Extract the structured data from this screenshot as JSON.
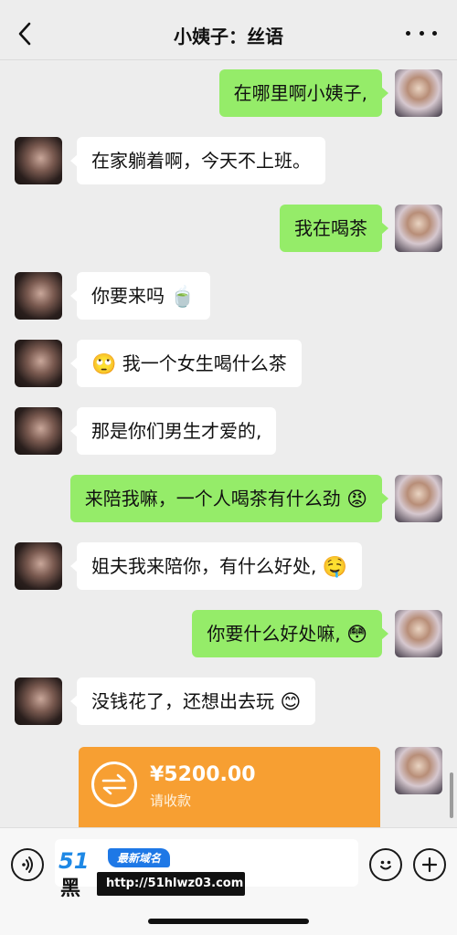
{
  "header": {
    "back_icon": "chevron-left-icon",
    "title": "小姨子：丝语",
    "more_icon": "more-dots-icon"
  },
  "messages": [
    {
      "sender": "me",
      "text": "在哪里啊小姨子,"
    },
    {
      "sender": "her",
      "text": "在家躺着啊，今天不上班。"
    },
    {
      "sender": "me",
      "text": "我在喝茶"
    },
    {
      "sender": "her",
      "text": "你要来吗",
      "emoji_after": "🍵"
    },
    {
      "sender": "her",
      "emoji_before": "🙄",
      "text": "我一个女生喝什么茶"
    },
    {
      "sender": "her",
      "text": "那是你们男生才爱的,"
    },
    {
      "sender": "me",
      "text": "来陪我嘛，一个人喝茶有什么劲",
      "emoji_after": "😡"
    },
    {
      "sender": "her",
      "text": "姐夫我来陪你，有什么好处,",
      "emoji_after": "🤤"
    },
    {
      "sender": "me",
      "text": "你要什么好处嘛,",
      "emoji_after": "😳"
    },
    {
      "sender": "her",
      "text": "没钱花了，还想出去玩",
      "emoji_after": "😊"
    }
  ],
  "transfer": {
    "amount": "¥5200.00",
    "status": "请收款",
    "icon": "transfer-arrows-icon",
    "color": "#f79f32"
  },
  "input_bar": {
    "voice_icon": "voice-icon",
    "emoji_icon": "emoji-icon",
    "plus_icon": "plus-icon"
  },
  "watermark": {
    "logo_number": "51",
    "logo_char": "黑",
    "tag": "最新域名",
    "url": "http://51hlwz03.com"
  },
  "colors": {
    "background": "#ededed",
    "my_bubble": "#95ec69",
    "her_bubble": "#ffffff"
  }
}
